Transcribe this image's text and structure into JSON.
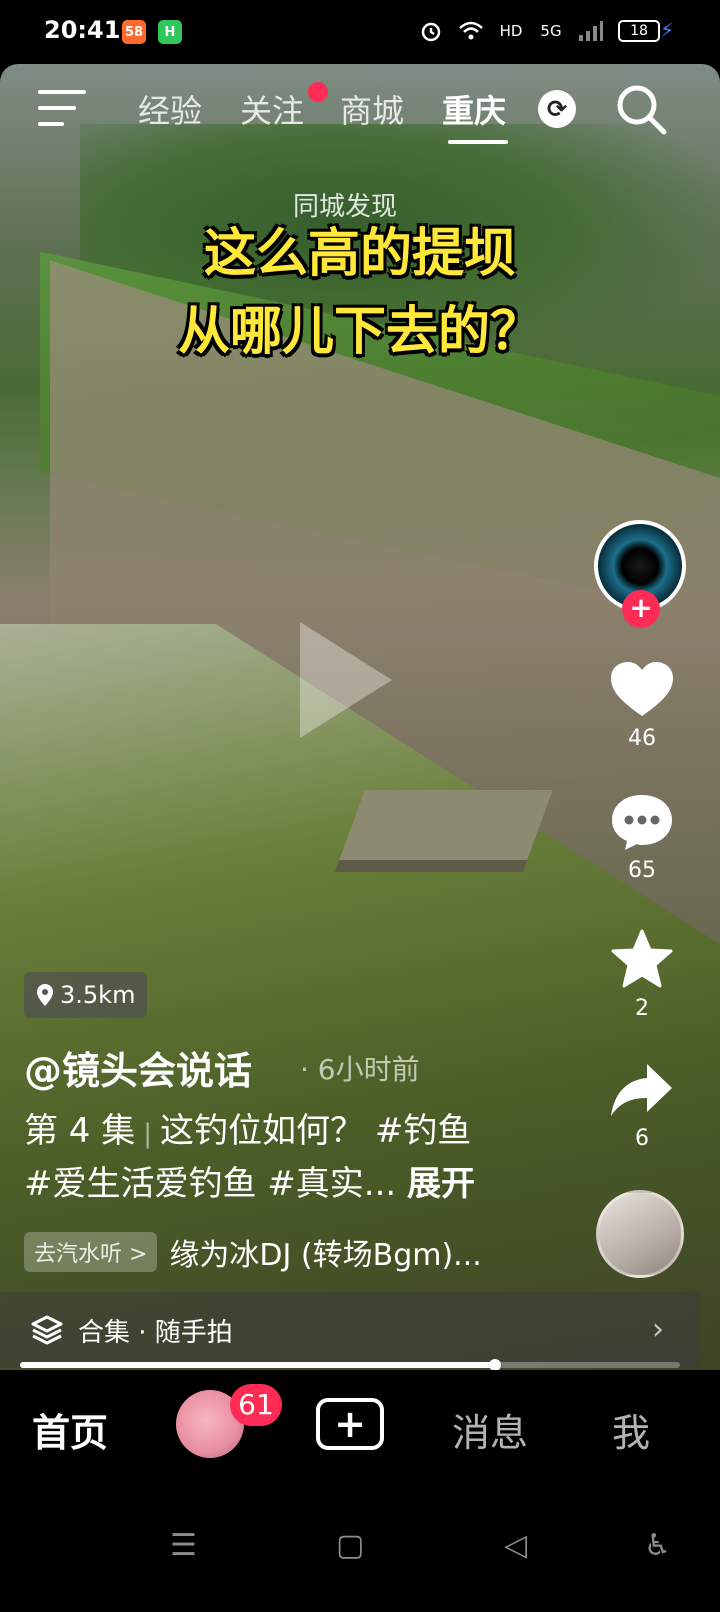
{
  "status_bar": {
    "time": "20:41",
    "app_badge_1": "58",
    "app_badge_2": "H",
    "battery": "18",
    "network": "5G",
    "hd_label": "HD"
  },
  "top_nav": {
    "tabs": [
      {
        "label": "经验",
        "active": false
      },
      {
        "label": "关注",
        "active": false
      },
      {
        "label": "商城",
        "active": false
      },
      {
        "label": "重庆",
        "active": true
      }
    ],
    "city_subtitle": "同城发现"
  },
  "video": {
    "headline_line1": "这么高的提坝",
    "headline_line2": "从哪儿下去的？",
    "progress": 0.72
  },
  "rail": {
    "likes": "46",
    "comments": "65",
    "favorites": "2",
    "shares": "6"
  },
  "post": {
    "distance": "3.5km",
    "author": "@镜头会说话",
    "time_ago": "· 6小时前",
    "episode": "第 4 集",
    "separator": "|",
    "caption_line1": "这钓位如何？ #钓鱼",
    "caption_line2": "#爱生活爱钓鱼 #真实...",
    "expand_label": "展开",
    "music_tag": "去汽水听 >",
    "music_name": "缘为冰DJ (转场Bgm)...",
    "collection_label": "合集 · 随手拍"
  },
  "bottom_nav": {
    "home": "首页",
    "friend_badge": "61",
    "messages": "消息",
    "me": "我"
  },
  "colors": {
    "accent": "#fe2c55",
    "headline": "#ffe83a"
  }
}
